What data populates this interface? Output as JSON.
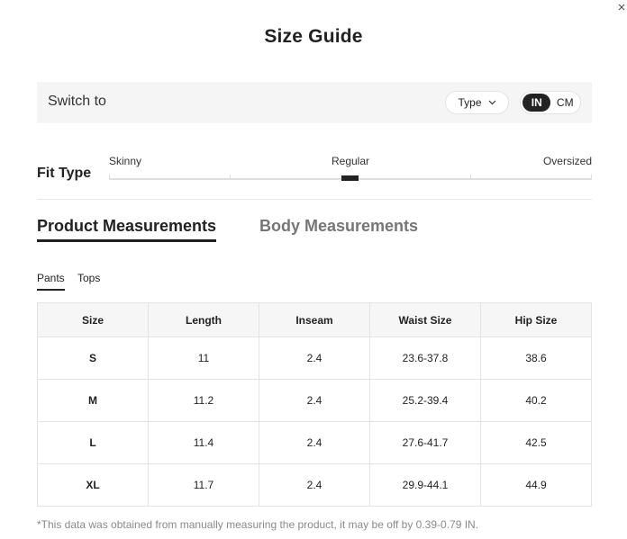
{
  "dialog": {
    "title": "Size Guide",
    "close_icon": "close-icon"
  },
  "switch_bar": {
    "label": "Switch to",
    "type_dropdown": {
      "label": "Type",
      "icon": "chevron-down-icon"
    },
    "units": {
      "options": [
        "IN",
        "CM"
      ],
      "selected": "IN"
    }
  },
  "fit_type": {
    "label": "Fit Type",
    "options": [
      "Skinny",
      "Regular",
      "Oversized"
    ],
    "selected": "Regular"
  },
  "measurement_tabs": {
    "items": [
      "Product Measurements",
      "Body Measurements"
    ],
    "active": "Product Measurements"
  },
  "category_tabs": {
    "items": [
      "Pants",
      "Tops"
    ],
    "active": "Pants"
  },
  "table": {
    "headers": [
      "Size",
      "Length",
      "Inseam",
      "Waist Size",
      "Hip Size"
    ],
    "rows": [
      [
        "S",
        "11",
        "2.4",
        "23.6-37.8",
        "38.6"
      ],
      [
        "M",
        "11.2",
        "2.4",
        "25.2-39.4",
        "40.2"
      ],
      [
        "L",
        "11.4",
        "2.4",
        "27.6-41.7",
        "42.5"
      ],
      [
        "XL",
        "11.7",
        "2.4",
        "29.9-44.1",
        "44.9"
      ]
    ]
  },
  "footnote": "*This data was obtained from manually measuring the product, it may be off by 0.39-0.79 IN."
}
